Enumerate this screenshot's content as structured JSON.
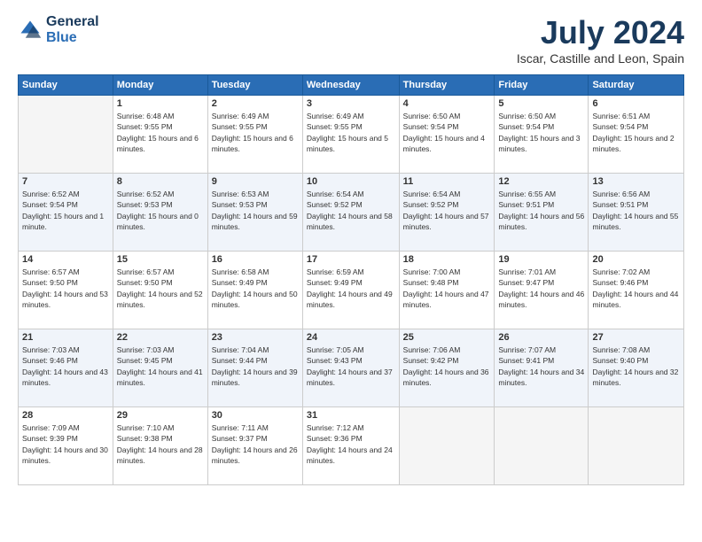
{
  "logo": {
    "line1": "General",
    "line2": "Blue"
  },
  "title": "July 2024",
  "location": "Iscar, Castille and Leon, Spain",
  "weekdays": [
    "Sunday",
    "Monday",
    "Tuesday",
    "Wednesday",
    "Thursday",
    "Friday",
    "Saturday"
  ],
  "weeks": [
    [
      {
        "day": "",
        "empty": true
      },
      {
        "day": "1",
        "sunrise": "6:48 AM",
        "sunset": "9:55 PM",
        "daylight": "15 hours and 6 minutes."
      },
      {
        "day": "2",
        "sunrise": "6:49 AM",
        "sunset": "9:55 PM",
        "daylight": "15 hours and 6 minutes."
      },
      {
        "day": "3",
        "sunrise": "6:49 AM",
        "sunset": "9:55 PM",
        "daylight": "15 hours and 5 minutes."
      },
      {
        "day": "4",
        "sunrise": "6:50 AM",
        "sunset": "9:54 PM",
        "daylight": "15 hours and 4 minutes."
      },
      {
        "day": "5",
        "sunrise": "6:50 AM",
        "sunset": "9:54 PM",
        "daylight": "15 hours and 3 minutes."
      },
      {
        "day": "6",
        "sunrise": "6:51 AM",
        "sunset": "9:54 PM",
        "daylight": "15 hours and 2 minutes."
      }
    ],
    [
      {
        "day": "7",
        "sunrise": "6:52 AM",
        "sunset": "9:54 PM",
        "daylight": "15 hours and 1 minute."
      },
      {
        "day": "8",
        "sunrise": "6:52 AM",
        "sunset": "9:53 PM",
        "daylight": "15 hours and 0 minutes."
      },
      {
        "day": "9",
        "sunrise": "6:53 AM",
        "sunset": "9:53 PM",
        "daylight": "14 hours and 59 minutes."
      },
      {
        "day": "10",
        "sunrise": "6:54 AM",
        "sunset": "9:52 PM",
        "daylight": "14 hours and 58 minutes."
      },
      {
        "day": "11",
        "sunrise": "6:54 AM",
        "sunset": "9:52 PM",
        "daylight": "14 hours and 57 minutes."
      },
      {
        "day": "12",
        "sunrise": "6:55 AM",
        "sunset": "9:51 PM",
        "daylight": "14 hours and 56 minutes."
      },
      {
        "day": "13",
        "sunrise": "6:56 AM",
        "sunset": "9:51 PM",
        "daylight": "14 hours and 55 minutes."
      }
    ],
    [
      {
        "day": "14",
        "sunrise": "6:57 AM",
        "sunset": "9:50 PM",
        "daylight": "14 hours and 53 minutes."
      },
      {
        "day": "15",
        "sunrise": "6:57 AM",
        "sunset": "9:50 PM",
        "daylight": "14 hours and 52 minutes."
      },
      {
        "day": "16",
        "sunrise": "6:58 AM",
        "sunset": "9:49 PM",
        "daylight": "14 hours and 50 minutes."
      },
      {
        "day": "17",
        "sunrise": "6:59 AM",
        "sunset": "9:49 PM",
        "daylight": "14 hours and 49 minutes."
      },
      {
        "day": "18",
        "sunrise": "7:00 AM",
        "sunset": "9:48 PM",
        "daylight": "14 hours and 47 minutes."
      },
      {
        "day": "19",
        "sunrise": "7:01 AM",
        "sunset": "9:47 PM",
        "daylight": "14 hours and 46 minutes."
      },
      {
        "day": "20",
        "sunrise": "7:02 AM",
        "sunset": "9:46 PM",
        "daylight": "14 hours and 44 minutes."
      }
    ],
    [
      {
        "day": "21",
        "sunrise": "7:03 AM",
        "sunset": "9:46 PM",
        "daylight": "14 hours and 43 minutes."
      },
      {
        "day": "22",
        "sunrise": "7:03 AM",
        "sunset": "9:45 PM",
        "daylight": "14 hours and 41 minutes."
      },
      {
        "day": "23",
        "sunrise": "7:04 AM",
        "sunset": "9:44 PM",
        "daylight": "14 hours and 39 minutes."
      },
      {
        "day": "24",
        "sunrise": "7:05 AM",
        "sunset": "9:43 PM",
        "daylight": "14 hours and 37 minutes."
      },
      {
        "day": "25",
        "sunrise": "7:06 AM",
        "sunset": "9:42 PM",
        "daylight": "14 hours and 36 minutes."
      },
      {
        "day": "26",
        "sunrise": "7:07 AM",
        "sunset": "9:41 PM",
        "daylight": "14 hours and 34 minutes."
      },
      {
        "day": "27",
        "sunrise": "7:08 AM",
        "sunset": "9:40 PM",
        "daylight": "14 hours and 32 minutes."
      }
    ],
    [
      {
        "day": "28",
        "sunrise": "7:09 AM",
        "sunset": "9:39 PM",
        "daylight": "14 hours and 30 minutes."
      },
      {
        "day": "29",
        "sunrise": "7:10 AM",
        "sunset": "9:38 PM",
        "daylight": "14 hours and 28 minutes."
      },
      {
        "day": "30",
        "sunrise": "7:11 AM",
        "sunset": "9:37 PM",
        "daylight": "14 hours and 26 minutes."
      },
      {
        "day": "31",
        "sunrise": "7:12 AM",
        "sunset": "9:36 PM",
        "daylight": "14 hours and 24 minutes."
      },
      {
        "day": "",
        "empty": true
      },
      {
        "day": "",
        "empty": true
      },
      {
        "day": "",
        "empty": true
      }
    ]
  ]
}
